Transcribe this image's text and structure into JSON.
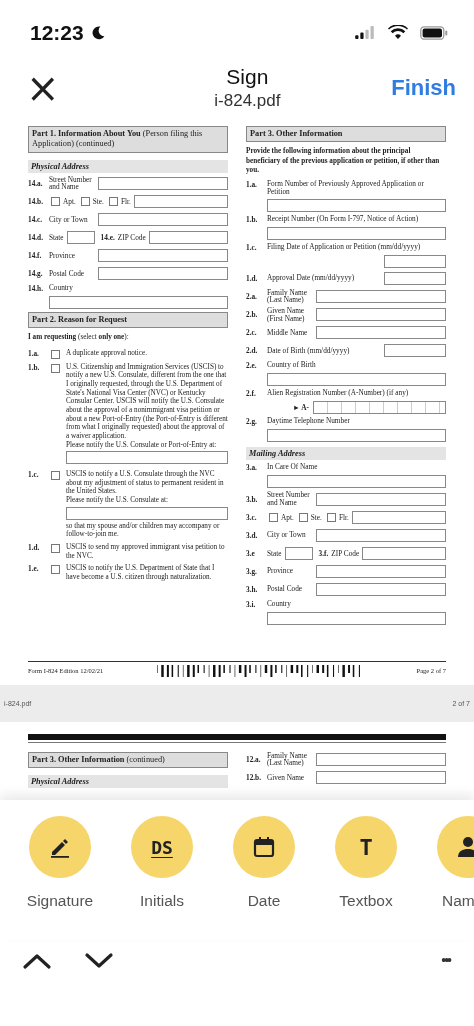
{
  "status_bar": {
    "time": "12:23"
  },
  "header": {
    "close": "×",
    "title": "Sign",
    "subtitle": "i-824.pdf",
    "action": "Finish"
  },
  "document": {
    "left": [
      {
        "kind": "part",
        "title": "Part 1.  Information About You",
        "note": "(Person filing this Application) (continued)"
      },
      {
        "kind": "subhead",
        "title": "Physical Address"
      },
      {
        "kind": "inline",
        "num": "14.a.",
        "label": "Street Number and Name"
      },
      {
        "kind": "unit",
        "num": "14.b.",
        "options": [
          {
            "label": "Apt.",
            "checked": false
          },
          {
            "label": "Ste.",
            "checked": false
          },
          {
            "label": "Flr.",
            "checked": false
          }
        ]
      },
      {
        "kind": "inline",
        "num": "14.c.",
        "label": "City or Town"
      },
      {
        "kind": "pair",
        "num": "14.d.",
        "label": "State",
        "num2": "14.e.",
        "label2": "ZIP Code"
      },
      {
        "kind": "inline",
        "num": "14.f.",
        "label": "Province"
      },
      {
        "kind": "inline",
        "num": "14.g.",
        "label": "Postal Code"
      },
      {
        "kind": "stacked",
        "num": "14.h.",
        "label": "Country"
      },
      {
        "kind": "part",
        "title": "Part 2.  Reason for Request"
      },
      {
        "kind": "lead",
        "text": "**I am requesting** (select **only one**):"
      },
      {
        "kind": "choice",
        "num": "1.a.",
        "checked": false,
        "text": "A duplicate approval notice."
      },
      {
        "kind": "choice",
        "num": "1.b.",
        "checked": false,
        "text": "U.S. Citizenship and Immigration Services (USCIS) to notify a new U.S. Consulate, different from the one that I originally requested, through the U.S. Department of State's National Visa Center (NVC) or Kentucky Consular Center.  USCIS will notify the U.S. Consulate about the approval of a nonimmigrant visa petition or about a new Port-of-Entry (the Port-of-Entry is different from what I originally requested) about the approval of a waiver application.",
        "prompt": "Please notify the U.S. Consulate or Port-of-Entry at:"
      },
      {
        "kind": "choice",
        "num": "1.c.",
        "checked": false,
        "text": "USCIS to notify a U.S. Consulate through the NVC about my adjustment of status to permanent resident in the United States.",
        "prompt": "Please notify the U.S. Consulate at:",
        "after": "so that my spouse and/or children may accompany or follow-to-join me."
      },
      {
        "kind": "choice",
        "num": "1.d.",
        "checked": false,
        "text": "USCIS to send my approved immigrant visa petition to the NVC."
      },
      {
        "kind": "choice",
        "num": "1.e.",
        "checked": false,
        "text": "USCIS to notify the U.S. Department of State that I have become a U.S. citizen through naturalization."
      }
    ],
    "right": [
      {
        "kind": "part",
        "title": "Part 3.  Other Information"
      },
      {
        "kind": "intro",
        "text": "Provide the following information about the principal beneficiary of the previous application or petition, if other than you."
      },
      {
        "kind": "stacked",
        "num": "1.a.",
        "label": "Form Number of Previously Approved Application or Petition"
      },
      {
        "kind": "stacked",
        "num": "1.b.",
        "label": "Receipt Number (On Form I-797, Notice of Action)"
      },
      {
        "kind": "short_below",
        "num": "1.c.",
        "label": "Filing Date of Application or Petition (mm/dd/yyyy)"
      },
      {
        "kind": "short_right",
        "num": "1.d.",
        "label": "Approval Date (mm/dd/yyyy)"
      },
      {
        "kind": "inline",
        "num": "2.a.",
        "label": "Family Name (Last Name)"
      },
      {
        "kind": "inline",
        "num": "2.b.",
        "label": "Given Name (First Name)"
      },
      {
        "kind": "inline",
        "num": "2.c.",
        "label": "Middle Name"
      },
      {
        "kind": "short_right",
        "num": "2.d.",
        "label": "Date of Birth (mm/dd/yyyy)"
      },
      {
        "kind": "stacked",
        "num": "2.e.",
        "label": "Country of Birth"
      },
      {
        "kind": "anumber",
        "num": "2.f.",
        "label": "Alien Registration Number (A-Number) (if any)",
        "prefix": "► A-"
      },
      {
        "kind": "stacked",
        "num": "2.g.",
        "label": "Daytime Telephone Number"
      },
      {
        "kind": "subhead",
        "title": "Mailing Address"
      },
      {
        "kind": "stacked",
        "num": "3.a.",
        "label": "In Care Of Name"
      },
      {
        "kind": "inline",
        "num": "3.b.",
        "label": "Street Number and Name"
      },
      {
        "kind": "unit",
        "num": "3.c.",
        "options": [
          {
            "label": "Apt.",
            "checked": false
          },
          {
            "label": "Ste.",
            "checked": false
          },
          {
            "label": "Flr.",
            "checked": false
          }
        ]
      },
      {
        "kind": "inline",
        "num": "3.d.",
        "label": "City or Town"
      },
      {
        "kind": "pair",
        "num": "3.e",
        "label": "State",
        "num2": "3.f.",
        "label2": "ZIP Code"
      },
      {
        "kind": "inline",
        "num": "3.g.",
        "label": "Province"
      },
      {
        "kind": "inline",
        "num": "3.h.",
        "label": "Postal Code"
      },
      {
        "kind": "stacked",
        "num": "3.i.",
        "label": "Country"
      }
    ],
    "footer": {
      "form": "Form I-824   Edition   12/02/21",
      "page": "Page 2 of 7"
    },
    "page_bar": {
      "file": "i-824.pdf",
      "page": "2 of 7"
    },
    "next_page": {
      "left": [
        {
          "kind": "part",
          "title": "Part 3.  Other Information",
          "note": "(continued)"
        },
        {
          "kind": "subhead",
          "title": "Physical Address"
        }
      ],
      "right": [
        {
          "kind": "inline",
          "num": "12.a.",
          "label": "Family Name (Last Name)"
        },
        {
          "kind": "inline",
          "num": "12.b.",
          "label": "Given Name"
        }
      ]
    }
  },
  "tools": [
    {
      "kind": "pen",
      "label": "Signature"
    },
    {
      "kind": "initials",
      "glyph": "DS",
      "label": "Initials"
    },
    {
      "kind": "calendar",
      "label": "Date"
    },
    {
      "kind": "text",
      "glyph": "T",
      "label": "Textbox"
    },
    {
      "kind": "person",
      "label": "Nam"
    }
  ],
  "nav": {
    "more": "•••"
  }
}
